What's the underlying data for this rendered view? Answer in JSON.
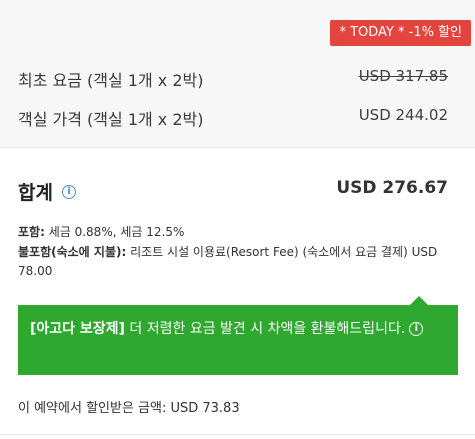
{
  "badge": "* TODAY * -1% 할인",
  "rows": [
    {
      "label": "최초 요금 (객실 1개 x 2박)",
      "price": "USD 317.85"
    },
    {
      "label": "객실 가격 (객실 1개 x 2박)",
      "price": "USD 244.02"
    }
  ],
  "total": {
    "label": "합계",
    "value": "USD 276.67"
  },
  "included": {
    "label": "포함:",
    "text": " 세금 0.88%, 세금 12.5%"
  },
  "excluded": {
    "label": "불포함(숙소에 지불):",
    "text": " 리조트 시설 이용료(Resort Fee) (숙소에서 요금 결제) USD 78.00"
  },
  "guarantee": {
    "bold": "[아고다 보장제]",
    "text": " 더 저렴한 요금 발견 시 차액을 환불해드립니다."
  },
  "saved": "이 예약에서 할인받은 금액: USD 73.83",
  "colors": {
    "badge": "#e4443e",
    "guarantee_bg": "#2ea82e",
    "info_icon": "#4a90d9"
  }
}
